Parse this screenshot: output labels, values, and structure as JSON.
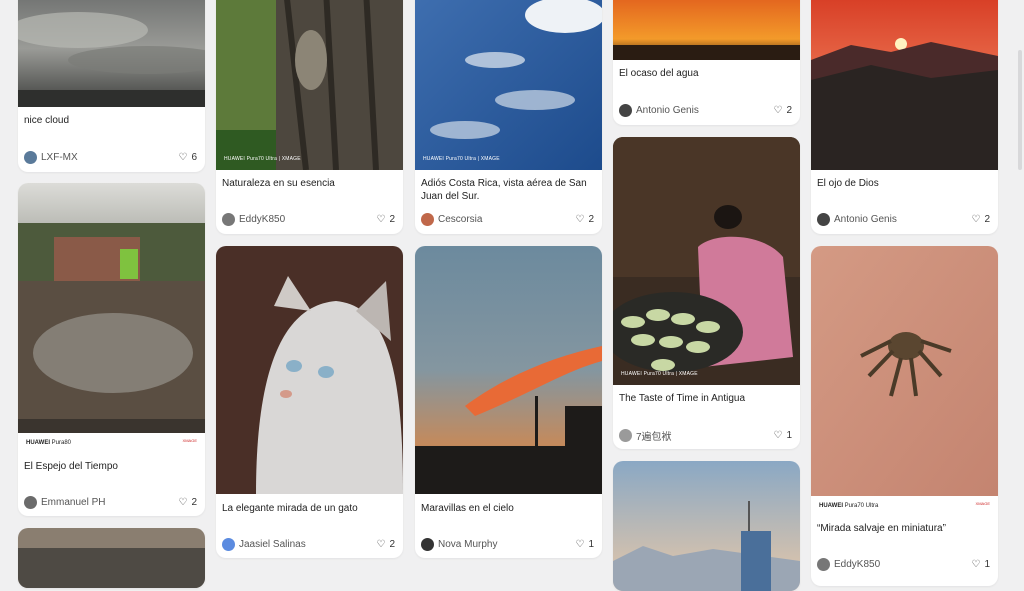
{
  "cards": {
    "c0": {
      "title": "nice cloud",
      "author": "LXF-MX",
      "likes": "6"
    },
    "c1": {
      "title": "El Espejo del Tiempo",
      "author": "Emmanuel PH",
      "likes": "2",
      "brand": "HUAWEI",
      "model": "Pura80",
      "xmage": "XMAGE"
    },
    "c3": {
      "title": "Naturaleza en su esencia",
      "author": "EddyK850",
      "likes": "2",
      "watermark": "HUAWEI Pura70 Ultra | XMAGE"
    },
    "c4": {
      "title": "La elegante mirada de un gato",
      "author": "Jaasiel Salinas",
      "likes": "2"
    },
    "c5": {
      "title": "Adiós Costa Rica, vista aérea de San Juan del Sur.",
      "author": "Cescorsia",
      "likes": "2",
      "watermark": "HUAWEI Pura70 Ultra | XMAGE"
    },
    "c6": {
      "title": "Maravillas en el cielo",
      "author": "Nova Murphy",
      "likes": "1"
    },
    "c7": {
      "title": "El ocaso del agua",
      "author": "Antonio Genis",
      "likes": "2"
    },
    "c8": {
      "title": "The Taste of Time in Antigua",
      "author": "7遍包袱",
      "likes": "1",
      "watermark": "HUAWEI Pura70 Ultra | XMAGE"
    },
    "c10": {
      "title": "El ojo de Dios",
      "author": "Antonio Genis",
      "likes": "2"
    },
    "c11": {
      "title": "“Mirada salvaje en miniatura”",
      "author": "EddyK850",
      "likes": "1",
      "brand": "HUAWEI",
      "model": "Pura70 Ultra",
      "xmage": "XMAGE"
    }
  },
  "icons": {
    "heart": "heart-outline-icon"
  },
  "colors": {
    "background": "#f0f0f1",
    "card": "#ffffff",
    "text": "#222222"
  }
}
